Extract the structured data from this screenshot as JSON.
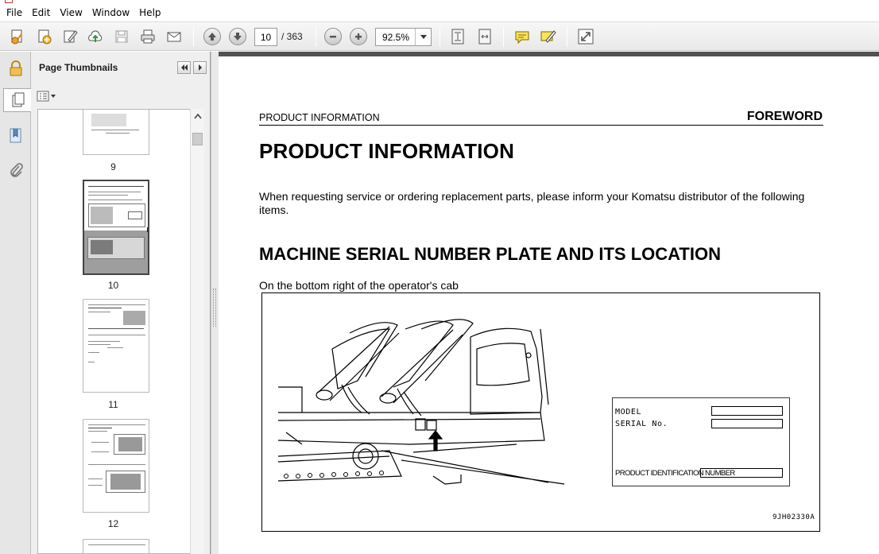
{
  "window": {
    "title": "",
    "app_icon": "adobe-reader-icon"
  },
  "menu": [
    "File",
    "Edit",
    "View",
    "Window",
    "Help"
  ],
  "toolbar": {
    "icons": [
      "create-pdf-icon",
      "attach-icon",
      "sign-icon",
      "upload-icon",
      "save-icon",
      "print-icon",
      "email-icon",
      "prev-page-icon",
      "next-page-icon",
      "zoom-out-icon",
      "zoom-in-icon",
      "fit-page-icon",
      "fit-width-icon",
      "comment-icon",
      "highlight-icon",
      "fullscreen-icon"
    ],
    "current_page": "10",
    "total_pages": "/ 363",
    "zoom": "92.5%"
  },
  "left_rail": {
    "icons": [
      "lock-icon",
      "page-thumbnails-icon",
      "bookmark-icon",
      "attachment-icon"
    ]
  },
  "thumbnails_panel": {
    "title": "Page Thumbnails",
    "thumbs": [
      {
        "label": "9"
      },
      {
        "label": "10"
      },
      {
        "label": "11"
      },
      {
        "label": "12"
      }
    ]
  },
  "document": {
    "header_left": "PRODUCT INFORMATION",
    "header_right": "FOREWORD",
    "h1": "PRODUCT INFORMATION",
    "paragraph": "When requesting service or ordering replacement parts, please inform your Komatsu distributor of the following items.",
    "h2": "MACHINE SERIAL NUMBER PLATE AND ITS LOCATION",
    "caption": "On the bottom right of the operator's cab",
    "figure": {
      "plate_model": "MODEL",
      "plate_serial": "SERIAL No.",
      "plate_pin": "PRODUCT IDENTIFICATION NUMBER",
      "figure_code": "9JH02330A"
    }
  }
}
